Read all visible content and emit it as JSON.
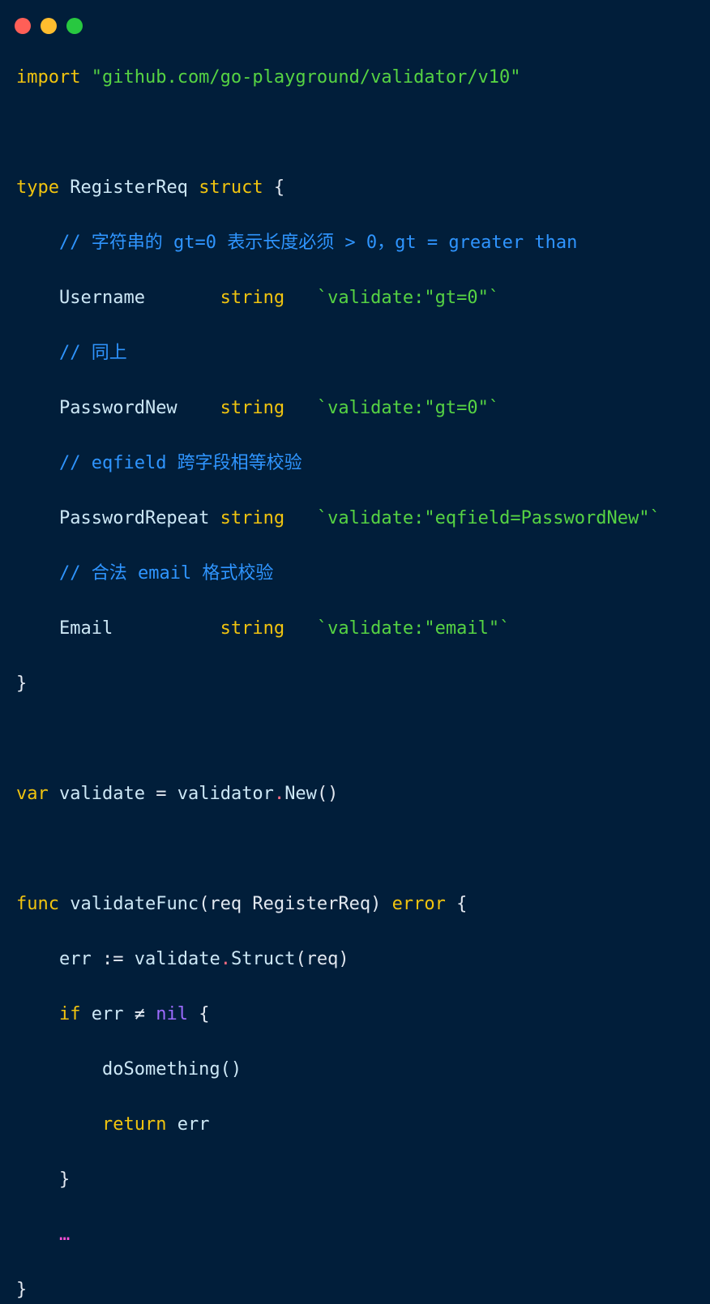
{
  "window": {
    "controls": [
      "close",
      "minimize",
      "maximize"
    ],
    "colors": {
      "background": "#011e3a",
      "close": "#ff5f57",
      "minimize": "#ffbd2e",
      "maximize": "#28c840",
      "keyword": "#f1c40f",
      "string": "#56d343",
      "comment": "#2f95ff",
      "operator_dot": "#ff6b81",
      "nil": "#9c6bff"
    }
  },
  "code": {
    "import_kw": "import",
    "import_path": "\"github.com/go-playground/validator/v10\"",
    "type_kw": "type",
    "struct_name": "RegisterReq",
    "struct_kw": "struct",
    "open_brace": "{",
    "close_brace": "}",
    "fields": [
      {
        "comment": "// 字符串的 gt=0 表示长度必须 > 0，gt = greater than",
        "name": "Username",
        "type": "string",
        "tag": "`validate:\"gt=0\"`"
      },
      {
        "comment": "// 同上",
        "name": "PasswordNew",
        "type": "string",
        "tag": "`validate:\"gt=0\"`"
      },
      {
        "comment": "// eqfield 跨字段相等校验",
        "name": "PasswordRepeat",
        "type": "string",
        "tag": "`validate:\"eqfield=PasswordNew\"`"
      },
      {
        "comment": "// 合法 email 格式校验",
        "name": "Email",
        "type": "string",
        "tag": "`validate:\"email\"`"
      }
    ],
    "var_kw": "var",
    "var_name": "validate",
    "assign": "=",
    "pkg": "validator",
    "new_call": "New",
    "parens": "()",
    "func_kw": "func",
    "func_name": "validateFunc",
    "func_params": "(req RegisterReq)",
    "func_return": "error",
    "err_decl": "err",
    "short_assign": ":=",
    "validate_obj": "validate",
    "struct_call": "Struct",
    "struct_args": "(req)",
    "if_kw": "if",
    "err_var": "err",
    "neq": "≠",
    "nil_kw": "nil",
    "do_something": "doSomething()",
    "return_kw": "return",
    "return_val": "err",
    "ellipsis": "…"
  }
}
